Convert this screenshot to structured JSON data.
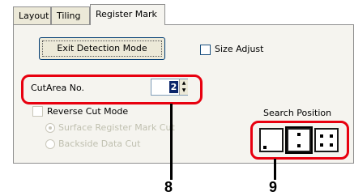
{
  "tabs": [
    {
      "label": "Layout"
    },
    {
      "label": "Tiling"
    },
    {
      "label": "Register Mark"
    }
  ],
  "buttons": {
    "exit_detection": "Exit Detection Mode"
  },
  "size_adjust": {
    "label": "Size Adjust",
    "checked": false
  },
  "cut_area": {
    "label": "CutArea No.",
    "value": "2"
  },
  "reverse_cut": {
    "label": "Reverse Cut Mode",
    "checked": false
  },
  "radios": [
    {
      "label": "Surface Register Mark Cut",
      "checked": true
    },
    {
      "label": "Backside Data Cut",
      "checked": false
    }
  ],
  "search_position": {
    "label": "Search Position",
    "options": [
      "one-dot",
      "two-dot",
      "four-dot"
    ],
    "selected": "two-dot"
  },
  "callouts": {
    "a": "8",
    "b": "9"
  },
  "colors": {
    "highlight": "#e8000f",
    "selection": "#0a246a"
  }
}
